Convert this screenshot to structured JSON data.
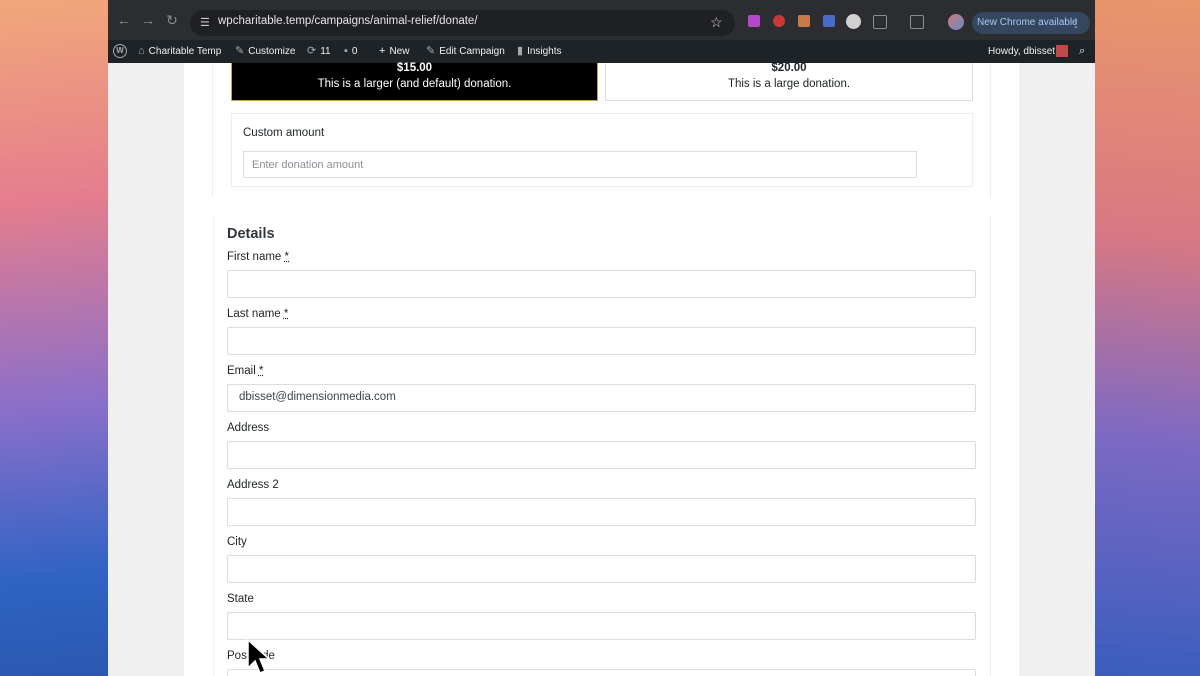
{
  "browser": {
    "url": "wpcharitable.temp/campaigns/animal-relief/donate/",
    "update_label": "New Chrome available"
  },
  "admin_bar": {
    "site_name": "Charitable Temp",
    "customize": "Customize",
    "updates_count": "11",
    "comments_count": "0",
    "new": "New",
    "edit_campaign": "Edit Campaign",
    "insights": "Insights",
    "howdy": "Howdy, dbisset"
  },
  "donation": {
    "amounts": [
      {
        "amount": "$15.00",
        "description": "This is a larger (and default) donation.",
        "selected": true
      },
      {
        "amount": "$20.00",
        "description": "This is a large donation.",
        "selected": false
      }
    ],
    "custom_label": "Custom amount",
    "custom_placeholder": "Enter donation amount"
  },
  "details": {
    "title": "Details",
    "fields": [
      {
        "label": "First name",
        "required": true,
        "value": ""
      },
      {
        "label": "Last name",
        "required": true,
        "value": ""
      },
      {
        "label": "Email",
        "required": true,
        "value": "dbisset@dimensionmedia.com"
      },
      {
        "label": "Address",
        "required": false,
        "value": ""
      },
      {
        "label": "Address 2",
        "required": false,
        "value": ""
      },
      {
        "label": "City",
        "required": false,
        "value": ""
      },
      {
        "label": "State",
        "required": false,
        "value": ""
      },
      {
        "label": "Postcode",
        "required": false,
        "value": ""
      }
    ],
    "required_marker": "*"
  }
}
